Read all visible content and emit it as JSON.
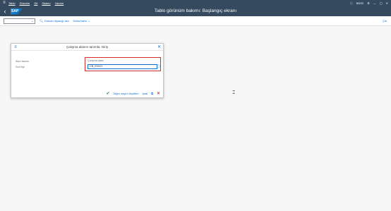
{
  "menubar": {
    "items": [
      "Tablo",
      "Düzenle",
      "Git",
      "Sistem",
      "Yardım"
    ],
    "client": "BDS2",
    "icons": [
      "help-icon",
      "settings-icon",
      "minimize-icon",
      "maximize-icon",
      "close-icon"
    ]
  },
  "header": {
    "title": "Tablo görünüm bakımı: Başlangıç ekranı",
    "logo": "SAP"
  },
  "toolbar": {
    "combo_value": "",
    "find_label": "Dokum ihyacığı ara",
    "more_label": "Daha fazla",
    "exit_label": "Çık"
  },
  "dialog": {
    "title": "Çalışma alanını tanımla: Giriş",
    "left_labels": [
      "Alan tanımı",
      "Sort tipi"
    ],
    "group_label": "Çalışma alanı",
    "input_value": "CB_ENVO",
    "footer": {
      "other_label": "Diğer seçim ölçütleri",
      "cancel_label": "İptal"
    }
  },
  "colors": {
    "shell": "#354a5f",
    "accent": "#0a6ed1",
    "highlight": "#d32f2f"
  }
}
